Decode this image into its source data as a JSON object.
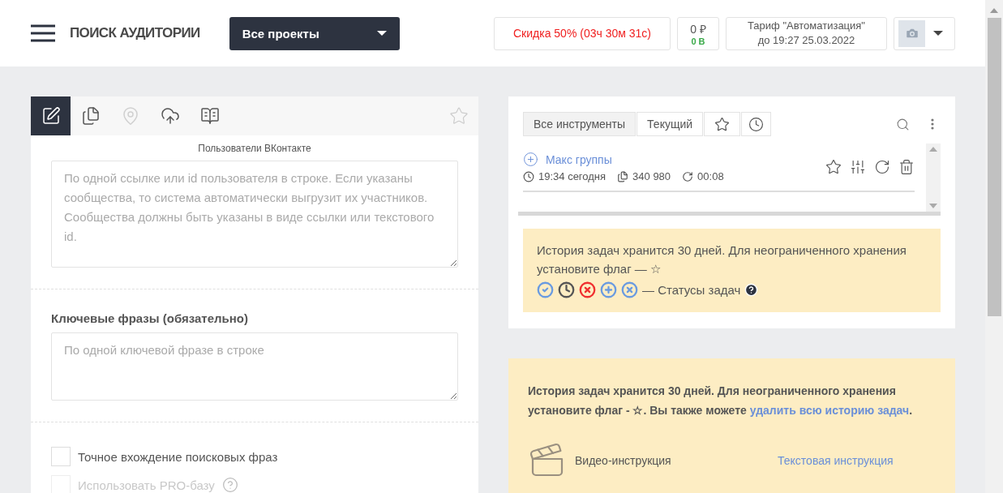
{
  "header": {
    "title": "ПОИСК АУДИТОРИИ",
    "project_select": {
      "value": "Все проекты"
    },
    "discount": "Скидка 50% (03ч 30м 31с)",
    "balance": {
      "money": "0 ₽",
      "points": "0 В"
    },
    "tariff": {
      "name": "Тариф \"Автоматизация\"",
      "until": "до 19:27 25.03.2022"
    }
  },
  "left_panel": {
    "tabs": [
      {
        "kind": "edit",
        "selected": true,
        "disabled": false
      },
      {
        "kind": "files",
        "selected": false,
        "disabled": false
      },
      {
        "kind": "location",
        "selected": false,
        "disabled": true
      },
      {
        "kind": "upload",
        "selected": false,
        "disabled": false
      },
      {
        "kind": "book",
        "selected": false,
        "disabled": false
      }
    ],
    "source": {
      "label": "Пользователи ВКонтакте",
      "placeholder": "По одной ссылке или id пользователя в строке. Если указаны сообщества, то система автоматически выгрузит их участников. Сообщества должны быть указаны в виде ссылки или текстового id."
    },
    "keywords": {
      "label": "Ключевые фразы (обязательно)",
      "placeholder": "По одной ключевой фразе в строке"
    },
    "options": [
      {
        "label": "Точное вхождение поисковых фраз",
        "checked": false,
        "disabled": false,
        "help": false
      },
      {
        "label": "Использовать PRO-базу",
        "checked": false,
        "disabled": true,
        "help": true
      }
    ]
  },
  "tools": {
    "tabs": [
      {
        "kind": "text",
        "label": "Все инструменты",
        "selected": true
      },
      {
        "kind": "text",
        "label": "Текущий",
        "selected": false
      },
      {
        "kind": "star",
        "selected": false
      },
      {
        "kind": "clock",
        "selected": false
      }
    ],
    "tasks": [
      {
        "name": "Макс группы",
        "time": "19:34 сегодня",
        "count": "340 980",
        "duration": "00:08"
      }
    ],
    "note": {
      "text": "История задач хранится 30 дней. Для неограниченного хранения установите флаг — ☆",
      "statuses": [
        {
          "kind": "done",
          "color": "#6a9be0"
        },
        {
          "kind": "waiting",
          "color": "#555555"
        },
        {
          "kind": "error",
          "color": "#f03030"
        },
        {
          "kind": "new",
          "color": "#6a9be0"
        },
        {
          "kind": "cancelled",
          "color": "#6a9be0"
        }
      ],
      "statuses_label": "— Статусы задач"
    }
  },
  "info": {
    "text": "История задач хранится 30 дней. Для неограниченного хранения установите флаг - ☆. Вы также можете",
    "link": "удалить всю историю задач",
    "end": ".",
    "video_label": "Видео-инструкция",
    "text_link": "Текстовая инструкция"
  }
}
